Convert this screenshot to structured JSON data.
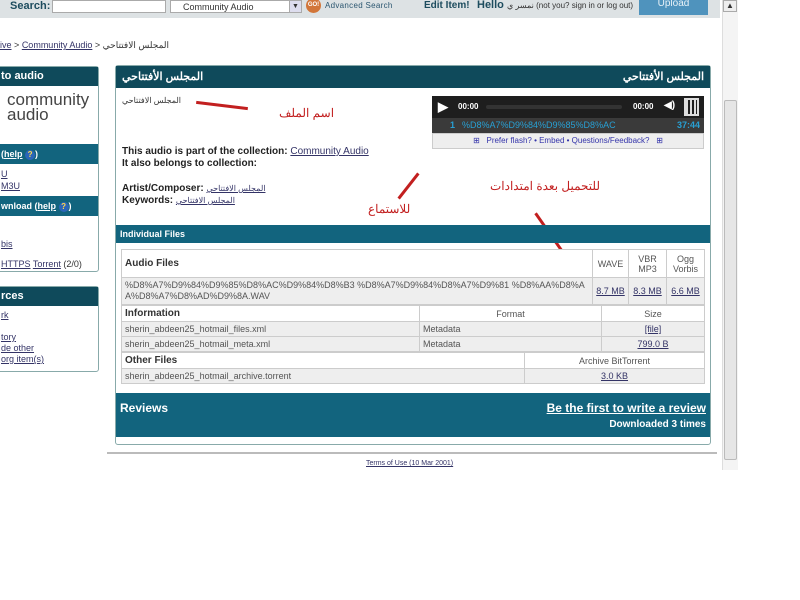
{
  "topbar": {
    "search_label": "Search:",
    "search_value": "",
    "collection": "Community Audio",
    "go": "GO!",
    "advanced": "Advanced Search",
    "edit": "Edit Item!",
    "hello": "Hello",
    "user": "نمسر ي",
    "user_note": "(not you? sign in or log out)",
    "upload": "Upload"
  },
  "breadcrumb": {
    "archive": "ive",
    "collection": "Community Audio",
    "sep": ">",
    "current": "المجلس الافتتاحي"
  },
  "sidebar": {
    "title": "to audio",
    "logo": "community audio",
    "stream_help": "help",
    "stream_items": [
      "U",
      "M3U"
    ],
    "download_title": "wnload",
    "download_help": "help",
    "download_items": [
      "bis"
    ],
    "torrent_https": "HTTPS",
    "torrent": "Torrent",
    "torrent_count": "(2/0)",
    "sources_title": "rces",
    "sources_items": [
      "rk",
      "",
      "tory",
      "de other",
      "org item(s)"
    ]
  },
  "main": {
    "title_left": "المجلس الأفتتاحي",
    "title_right": "المجلس الأفتتاحي",
    "item_name": "المجلس الافتتاحي",
    "collection_label": "This audio is part of the collection:",
    "collection_link": "Community Audio",
    "also_belongs": "It also belongs to collection:",
    "artist_label": "Artist/Composer:",
    "artist": "المجلس الافتتاحي",
    "keywords_label": "Keywords:",
    "keywords": "المجلس الافتتاحي"
  },
  "player": {
    "time_left": "00:00",
    "time_right": "00:00",
    "track_no": "1",
    "track": "%D8%A7%D9%84%D9%85%D8%AC",
    "duration": "37:44",
    "links": "Prefer flash? • Embed • Questions/Feedback?"
  },
  "annotations": {
    "file_name": "اسم الملف",
    "listen": "للاستماع",
    "download_formats": "للتحميل بعدة امتدادات"
  },
  "files": {
    "header": "Individual Files",
    "audio_header": "Audio Files",
    "cols": [
      "WAVE",
      "VBR MP3",
      "Ogg Vorbis"
    ],
    "audio_file": "%D8%A7%D9%84%D9%85%D8%AC%D9%84%D8%B3 %D8%A7%D9%84%D8%A7%D9%81 %D8%AA%D8%AA%D8%A7%D8%AD%D9%8A.WAV",
    "sizes": [
      "8.7 MB",
      "8.3 MB",
      "6.6 MB"
    ],
    "info_header": "Information",
    "format_header": "Format",
    "size_header": "Size",
    "info_rows": [
      {
        "name": "sherin_abdeen25_hotmail_files.xml",
        "format": "Metadata",
        "size": "[file]"
      },
      {
        "name": "sherin_abdeen25_hotmail_meta.xml",
        "format": "Metadata",
        "size": "799.0 B"
      }
    ],
    "other_header": "Other Files",
    "other_col": "Archive BitTorrent",
    "other_rows": [
      {
        "name": "sherin_abdeen25_hotmail_archive.torrent",
        "size": "3.0 KB"
      }
    ]
  },
  "reviews": {
    "title": "Reviews",
    "write": "Be the first to write a review",
    "downloads": "Downloaded 3 times"
  },
  "footer": {
    "terms": "Terms of Use (10 Mar 2001)"
  },
  "colors": {
    "header": "#0f4a5b",
    "section": "#12647e",
    "upload": "#4f93bd",
    "annotation": "#c21f1f"
  }
}
